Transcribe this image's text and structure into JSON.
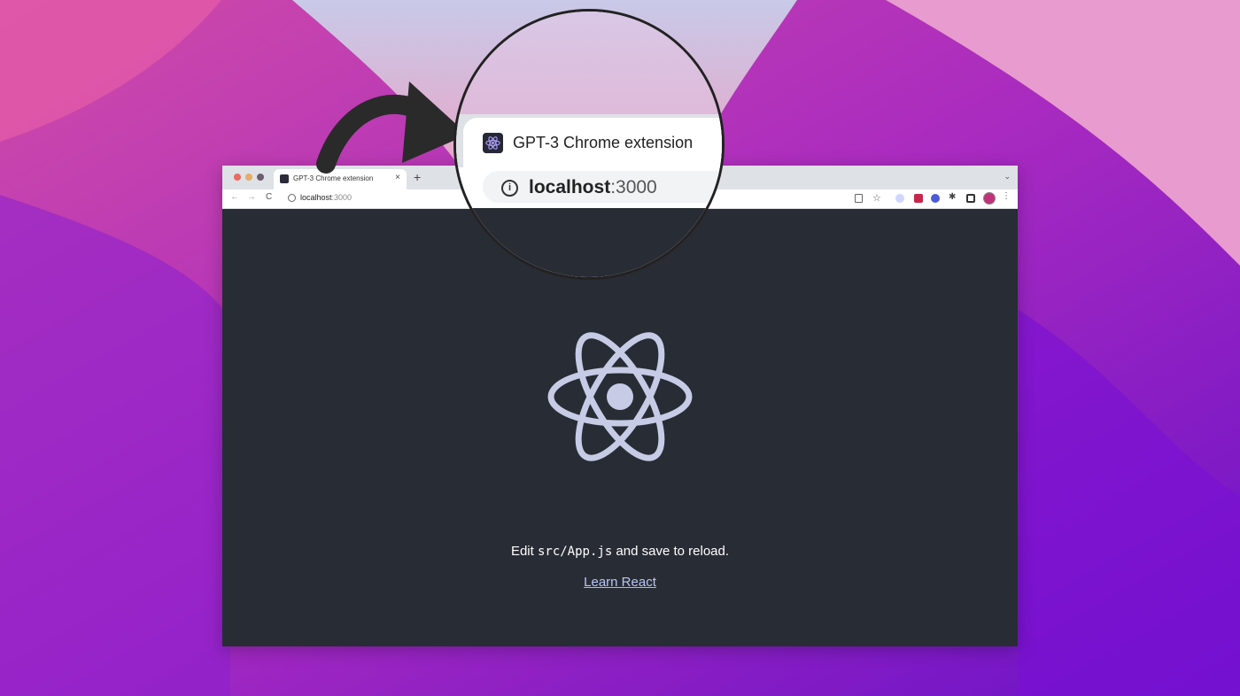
{
  "tab": {
    "title": "GPT-3 Chrome extension",
    "close": "×",
    "new_tab": "+"
  },
  "toolbar": {
    "back": "←",
    "forward": "→",
    "reload": "C",
    "url_host": "localhost",
    "url_port": ":3000",
    "star": "☆",
    "extensions": "✱",
    "menu": "⋮",
    "tabstrip_menu": "⌄"
  },
  "magnifier": {
    "tab_title": "GPT-3 Chrome extension",
    "info": "i",
    "url_host": "localhost",
    "url_port": ":3000"
  },
  "page": {
    "edit_before": "Edit ",
    "edit_code": "src/App.js",
    "edit_after": " and save to reload.",
    "link": "Learn React"
  },
  "colors": {
    "page_bg": "#282c34",
    "react_logo": "#c8cbe6",
    "link": "#b9c6f5"
  },
  "icons": [
    "react-logo-icon",
    "info-icon",
    "star-icon",
    "extension-icon",
    "profile-icon",
    "curved-arrow-icon"
  ]
}
